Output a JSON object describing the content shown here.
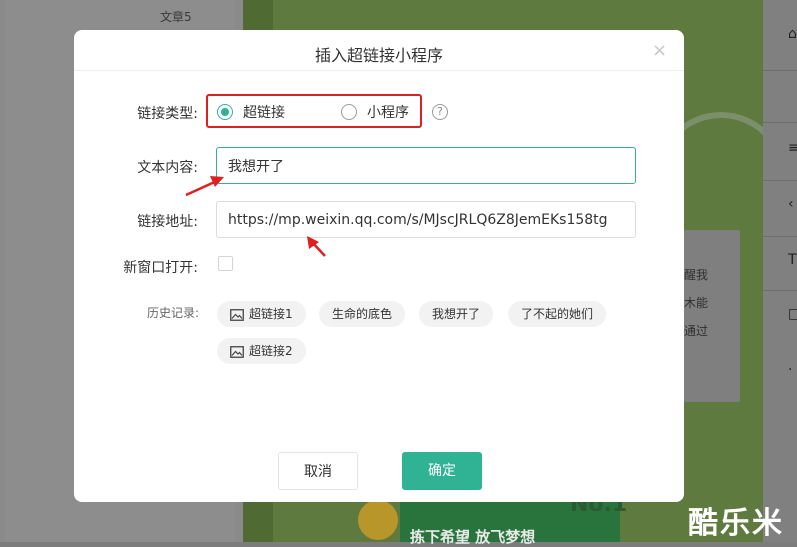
{
  "background": {
    "article_label": "文章5",
    "card_lines": [
      "醒我",
      "木能",
      "通过"
    ],
    "banner_text": "拣下希望 放飞梦想",
    "badge_text": "No.1",
    "watermark": "酷乐米"
  },
  "dialog": {
    "title": "插入超链接小程序",
    "close_glyph": "×",
    "link_type": {
      "label": "链接类型:",
      "options": [
        {
          "label": "超链接",
          "checked": true
        },
        {
          "label": "小程序",
          "checked": false
        }
      ],
      "help_glyph": "?"
    },
    "text_content": {
      "label": "文本内容:",
      "value": "我想开了"
    },
    "link_url": {
      "label": "链接地址:",
      "value": "https://mp.weixin.qq.com/s/MJscJRLQ6Z8JemEKs158tg"
    },
    "new_window": {
      "label": "新窗口打开:",
      "checked": false
    },
    "history": {
      "label": "历史记录:",
      "items": [
        {
          "label": "超链接1",
          "icon": "image-icon"
        },
        {
          "label": "生命的底色",
          "icon": ""
        },
        {
          "label": "我想开了",
          "icon": ""
        },
        {
          "label": "了不起的她们",
          "icon": ""
        },
        {
          "label": "超链接2",
          "icon": "image-icon"
        }
      ]
    },
    "buttons": {
      "cancel": "取消",
      "confirm": "确定"
    }
  },
  "colors": {
    "accent": "#2fb394",
    "annotation_red": "#e02020",
    "overlay": "#7c7c7c"
  }
}
